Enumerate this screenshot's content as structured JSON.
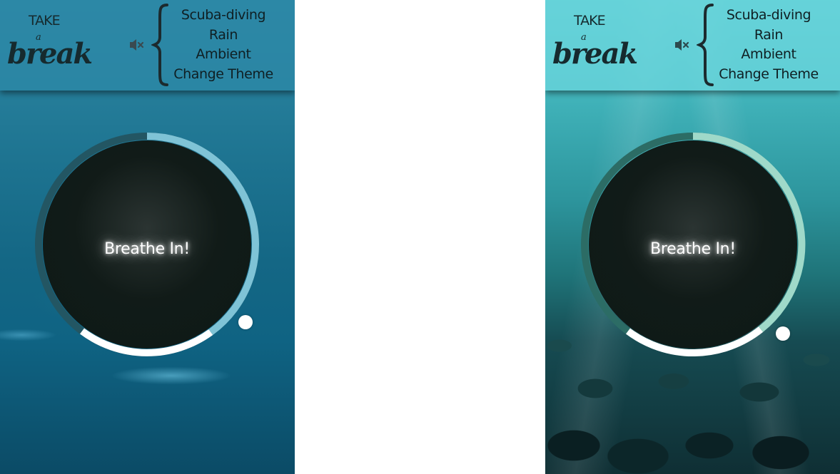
{
  "panels": [
    {
      "theme": "calm water",
      "logo": {
        "take": "TAKE",
        "a": "a",
        "break": "break"
      },
      "menu": [
        "Scuba-diving",
        "Rain",
        "Ambient",
        "Change Theme"
      ],
      "breathe_text": "Breathe In!",
      "colors": {
        "ring_track": "#235663",
        "ring_progress": "#7fc3d6",
        "ring_white": "#ffffff"
      },
      "progress": 0.3,
      "icons": [
        "mute-speaker-icon"
      ]
    },
    {
      "theme": "underwater",
      "logo": {
        "take": "TAKE",
        "a": "a",
        "break": "break"
      },
      "menu": [
        "Scuba-diving",
        "Rain",
        "Ambient",
        "Change Theme"
      ],
      "breathe_text": "Breathe In!",
      "colors": {
        "ring_track": "#2c6c65",
        "ring_progress": "#9fd9c9",
        "ring_white": "#ffffff"
      },
      "progress": 0.33,
      "icons": [
        "mute-speaker-icon"
      ]
    }
  ]
}
